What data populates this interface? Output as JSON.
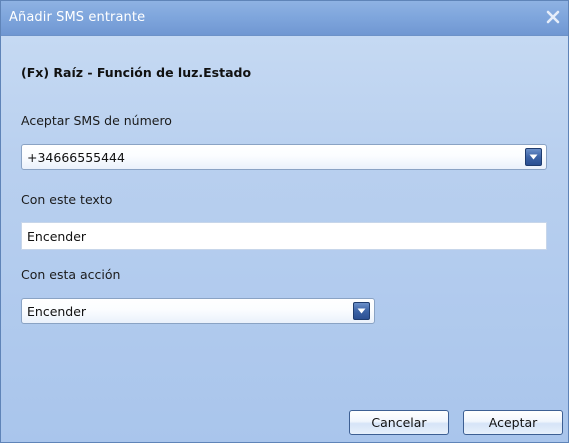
{
  "dialog": {
    "title": "Añadir SMS entrante",
    "close_icon": "close-icon"
  },
  "section_title": "(Fx) Raíz - Función de luz.Estado",
  "fields": {
    "number_label": "Aceptar SMS de número",
    "number_value": "+34666555444",
    "text_label": "Con este texto",
    "text_value": "Encender",
    "action_label": "Con esta acción",
    "action_value": "Encender"
  },
  "buttons": {
    "cancel": "Cancelar",
    "accept": "Aceptar"
  },
  "colors": {
    "title_bar": "#7ea5dc",
    "dialog_background": "#b9d0ef",
    "dropdown_button": "#3c63a6"
  }
}
